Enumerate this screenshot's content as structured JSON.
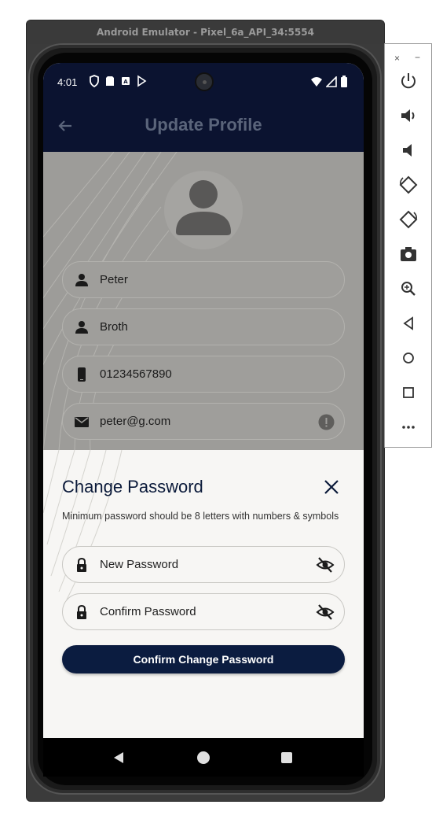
{
  "emulator": {
    "title": "Android Emulator - Pixel_6a_API_34:5554",
    "side_controls": [
      {
        "name": "power-icon"
      },
      {
        "name": "volume-up-icon"
      },
      {
        "name": "volume-down-icon"
      },
      {
        "name": "rotate-left-icon"
      },
      {
        "name": "rotate-right-icon"
      },
      {
        "name": "camera-screenshot-icon"
      },
      {
        "name": "zoom-icon"
      },
      {
        "name": "back-icon"
      },
      {
        "name": "home-icon"
      },
      {
        "name": "overview-icon"
      },
      {
        "name": "more-icon"
      }
    ],
    "close_label": "×",
    "minimize_label": "−"
  },
  "status_bar": {
    "time": "4:01"
  },
  "app_bar": {
    "title": "Update Profile"
  },
  "profile": {
    "first_name": "Peter",
    "last_name": "Broth",
    "phone": "01234567890",
    "email": "peter@g.com"
  },
  "sheet": {
    "title": "Change Password",
    "description": "Minimum password should be 8 letters with numbers & symbols",
    "new_password_placeholder": "New Password",
    "confirm_password_placeholder": "Confirm Password",
    "confirm_button": "Confirm Change Password"
  },
  "colors": {
    "primary": "#0b1c40",
    "app_bar": "#0b1330",
    "sheet_background": "#f7f6f4"
  }
}
